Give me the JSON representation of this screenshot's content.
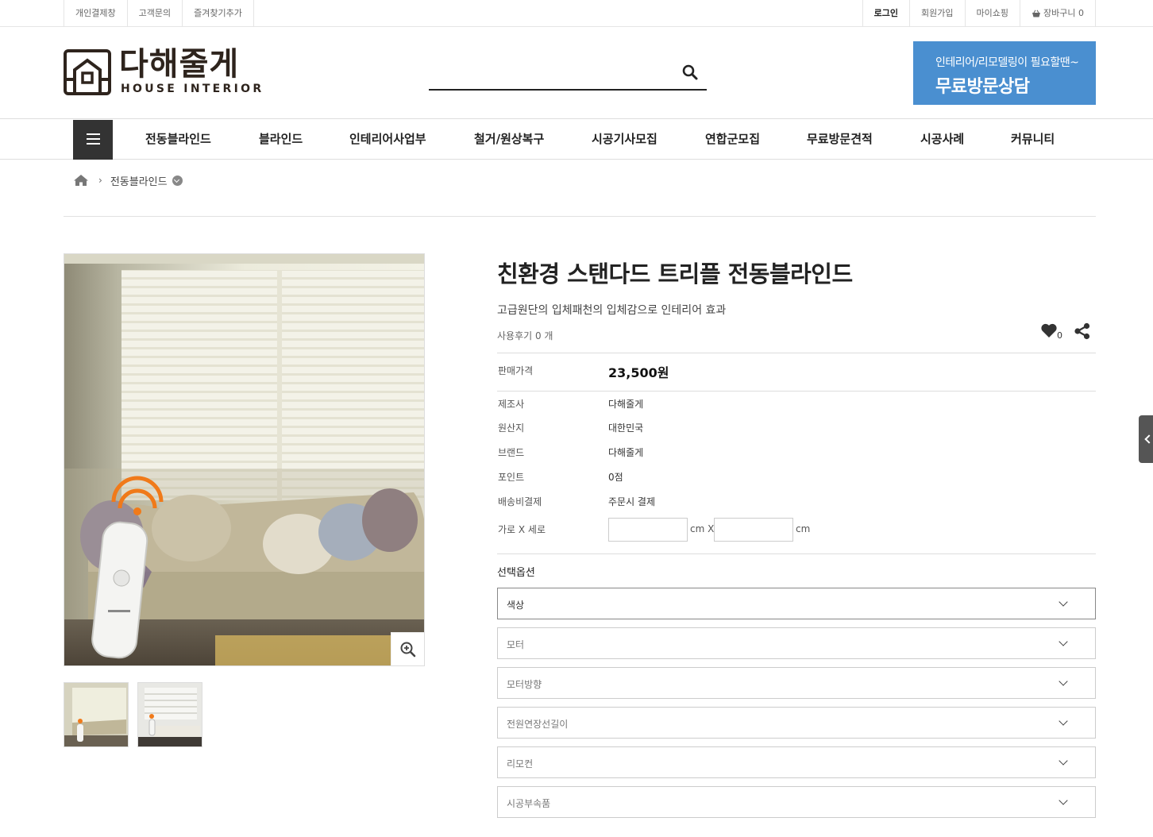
{
  "topbar": {
    "left": [
      "개인결제창",
      "고객문의",
      "즐겨찾기추가"
    ],
    "login": "로그인",
    "join": "회원가입",
    "mypage": "마이쇼핑",
    "cart": "장바구니 0"
  },
  "header": {
    "logo_kr": "다해줄게",
    "logo_en": "HOUSE INTERIOR",
    "search_placeholder": "",
    "consult_sub": "인테리어/리모델링이 필요할땐~",
    "consult_main": "무료방문상담"
  },
  "nav": [
    "전동블라인드",
    "블라인드",
    "인테리어사업부",
    "철거/원상복구",
    "시공기사모집",
    "연합군모집",
    "무료방문견적",
    "시공사례",
    "커뮤니티"
  ],
  "breadcrumb": {
    "current": "전동블라인드"
  },
  "product": {
    "title": "친환경 스탠다드 트리플 전동블라인드",
    "description": "고급원단의 입체패천의 입체감으로 인테리어 효과",
    "review": "사용후기 0 개",
    "wish_count": "0",
    "price_label": "판매가격",
    "price": "23,500원",
    "specs": [
      {
        "label": "제조사",
        "value": "다해줄게"
      },
      {
        "label": "원산지",
        "value": "대한민국"
      },
      {
        "label": "브랜드",
        "value": "다해줄게"
      },
      {
        "label": "포인트",
        "value": "0점"
      },
      {
        "label": "배송비결제",
        "value": "주문시 결제"
      }
    ],
    "size_label": "가로 X 세로",
    "size_unit_1": "cm X",
    "size_unit_2": "cm",
    "options_title": "선택옵션",
    "options": [
      "색상",
      "모터",
      "모터방향",
      "전원연장선길이",
      "리모컨",
      "시공부속품"
    ]
  },
  "colors": {
    "accent": "#4a8fd0",
    "menu_btn": "#333333",
    "brand": "#2e241d",
    "signal": "#f07a1a"
  }
}
